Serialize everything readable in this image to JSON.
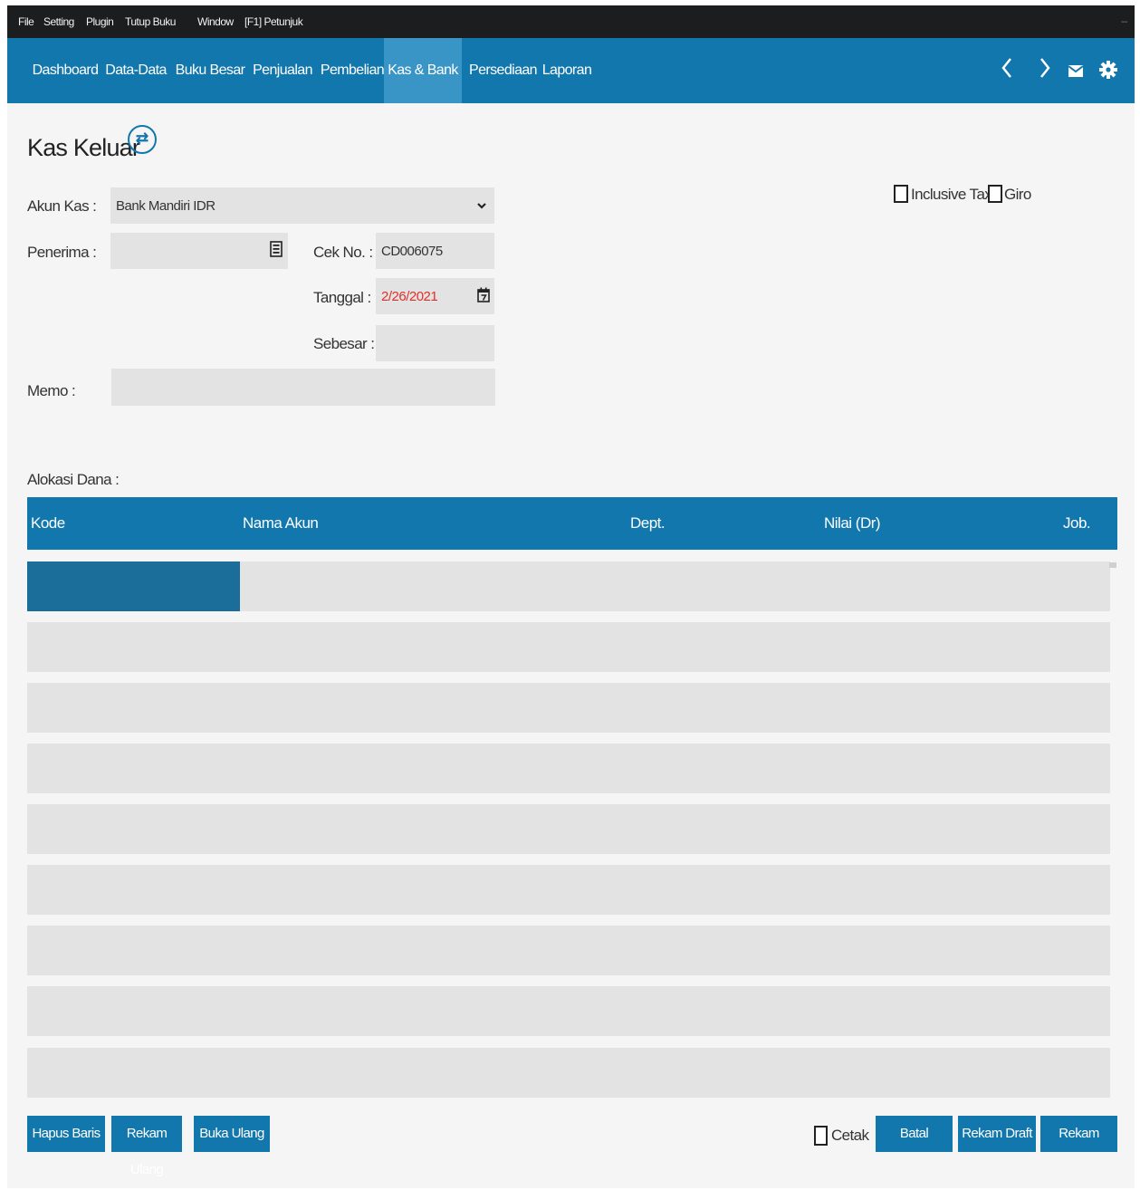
{
  "menu": [
    "File",
    "Setting",
    "Plugin",
    "Tutup Buku",
    "Window",
    "[F1] Petunjuk"
  ],
  "window": {
    "minimize": "–"
  },
  "nav": {
    "tabs": [
      "Dashboard",
      "Data-Data",
      "Buku Besar",
      "Penjualan",
      "Pembelian",
      "Kas & Bank",
      "Persediaan",
      "Laporan"
    ],
    "active_tab": "Kas & Bank",
    "icons": [
      "chevron-left-icon",
      "chevron-right-icon",
      "mail-icon",
      "gear-icon"
    ]
  },
  "form": {
    "title": "Kas Keluar",
    "akun_kas_label": "Akun Kas :",
    "akun_kas_value": "Bank Mandiri IDR",
    "penerima_label": "Penerima :",
    "penerima_value": "",
    "cek_no_label": "Cek No. :",
    "cek_no_value": "CD006075",
    "tanggal_label": "Tanggal :",
    "tanggal_value": "2/26/2021",
    "sebesar_label": "Sebesar :",
    "sebesar_value": "",
    "memo_label": "Memo :",
    "memo_value": "",
    "inclusive_tax_label": "Inclusive Tax",
    "giro_label": "Giro",
    "inclusive_tax_checked": false,
    "giro_checked": false
  },
  "grid": {
    "label": "Alokasi Dana :",
    "columns": [
      "Kode",
      "Nama Akun",
      "Dept.",
      "Nilai (Dr)",
      "Job."
    ],
    "rows": 9
  },
  "buttons": {
    "hapus_baris": "Hapus Baris",
    "rekam_ulang": "Rekam Ulang",
    "buka_ulang": "Buka Ulang",
    "cetak": "Cetak",
    "batal": "Batal",
    "rekam_draft": "Rekam Draft",
    "rekam": "Rekam"
  },
  "colors": {
    "primary": "#1277ad",
    "active_tab": "#3a95c7",
    "menubar": "#1c1d1f",
    "date_text": "#e0302a"
  }
}
